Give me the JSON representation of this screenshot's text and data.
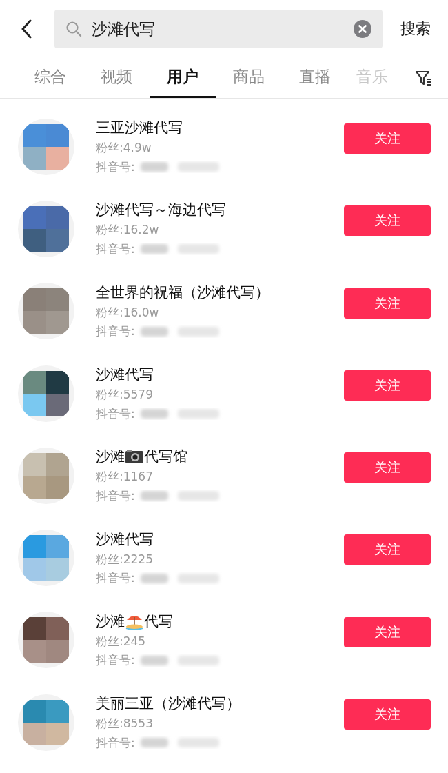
{
  "search": {
    "value": "沙滩代写",
    "action": "搜索"
  },
  "tabs": [
    {
      "label": "综合",
      "selected": false
    },
    {
      "label": "视频",
      "selected": false
    },
    {
      "label": "用户",
      "selected": true
    },
    {
      "label": "商品",
      "selected": false
    },
    {
      "label": "直播",
      "selected": false
    },
    {
      "label": "音乐",
      "selected": false
    }
  ],
  "users": [
    {
      "name": "三亚沙滩代写",
      "fans": "粉丝:4.9w",
      "id_label": "抖音号:",
      "button": "关注"
    },
    {
      "name": "沙滩代写～海边代写",
      "fans": "粉丝:16.2w",
      "id_label": "抖音号:",
      "button": "关注"
    },
    {
      "name": "全世界的祝福（沙滩代写）",
      "fans": "粉丝:16.0w",
      "id_label": "抖音号:",
      "button": "关注"
    },
    {
      "name": "沙滩代写",
      "fans": "粉丝:5579",
      "id_label": "抖音号:",
      "button": "关注"
    },
    {
      "name": "沙滩",
      "kind": "camera",
      "name_end": "代写馆",
      "fans": "粉丝:1167",
      "id_label": "抖音号:",
      "button": "关注"
    },
    {
      "name": "沙滩代写",
      "fans": "粉丝:2225",
      "id_label": "抖音号:",
      "button": "关注"
    },
    {
      "name": "沙滩",
      "kind": "beach",
      "name_end": "代写",
      "fans": "粉丝:245",
      "id_label": "抖音号:",
      "button": "关注"
    },
    {
      "name": "美丽三亚（沙滩代写）",
      "fans": "粉丝:8553",
      "id_label": "抖音号:",
      "button": "关注"
    }
  ]
}
